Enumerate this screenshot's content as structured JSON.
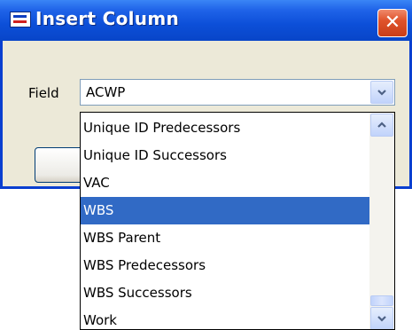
{
  "window": {
    "title": "Insert Column",
    "close_icon": "close-icon"
  },
  "form": {
    "field_label": "Field",
    "field_value": "ACWP"
  },
  "dropdown": {
    "items": [
      "Unique ID Predecessors",
      "Unique ID Successors",
      "VAC",
      "WBS",
      "WBS Parent",
      "WBS Predecessors",
      "WBS Successors",
      "Work"
    ],
    "selected": "WBS"
  },
  "colors": {
    "titlebar": "#0c4fd8",
    "selection": "#316ac5",
    "close": "#e0532c",
    "dialog_face": "#ece9d8"
  }
}
